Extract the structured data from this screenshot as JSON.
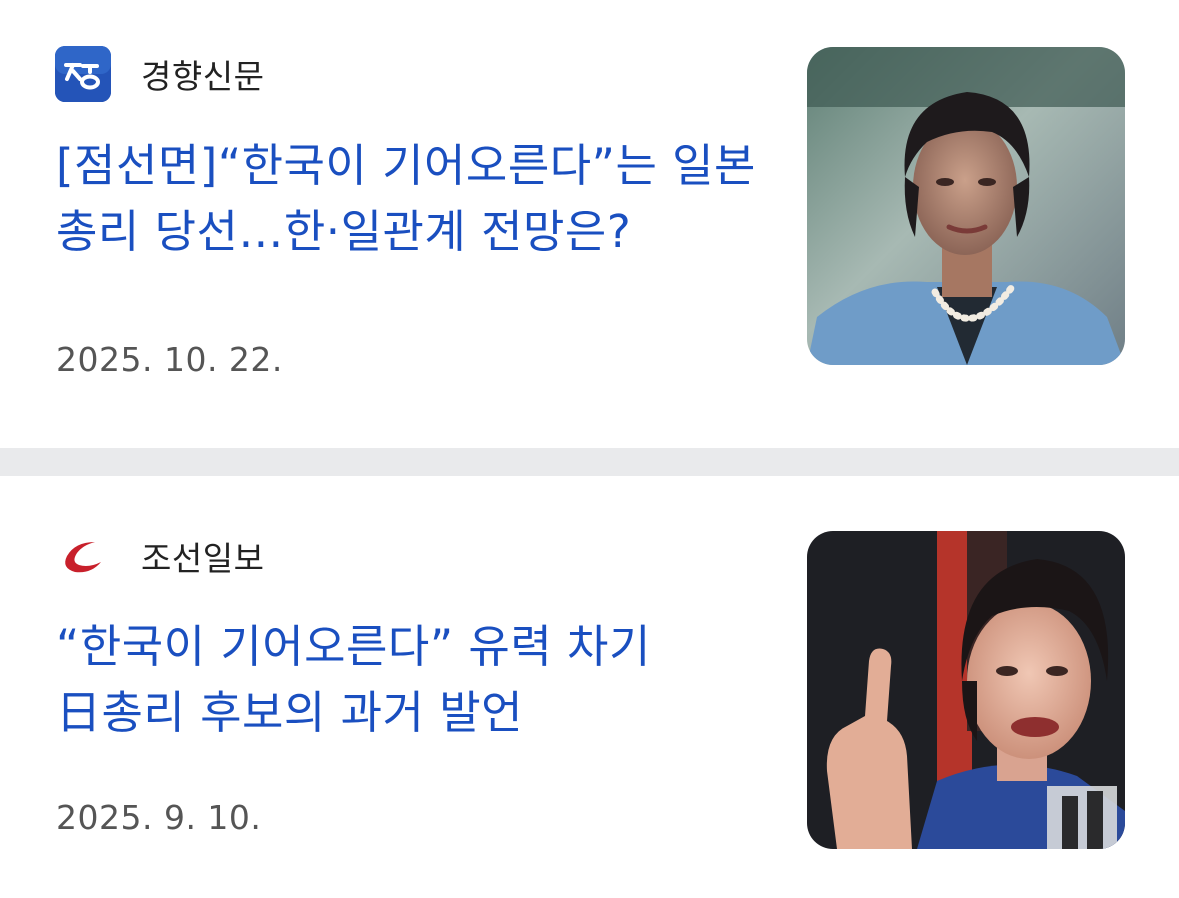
{
  "articles": [
    {
      "source": "경향신문",
      "source_logo_icon": "kyunghyang-logo-icon",
      "headline": "[점선면]“한국이 기어오른다”는 일본 총리 당선…한·일관계 전망은?",
      "date": "2025. 10. 22.",
      "thumbnail": "portrait-photo-woman-pearl-necklace"
    },
    {
      "source": "조선일보",
      "source_logo_icon": "chosun-logo-icon",
      "headline": "“한국이 기어오른다” 유력 차기 日총리 후보의 과거 발언",
      "date": "2025. 9. 10.",
      "thumbnail": "portrait-photo-woman-pointing-finger"
    }
  ],
  "colors": {
    "headline": "#1a4fc0",
    "source_text": "#222222",
    "date_text": "#555555",
    "divider": "#e9eaec",
    "kyunghyang_logo_bg": "#2454b8",
    "chosun_logo": "#c8202b"
  }
}
